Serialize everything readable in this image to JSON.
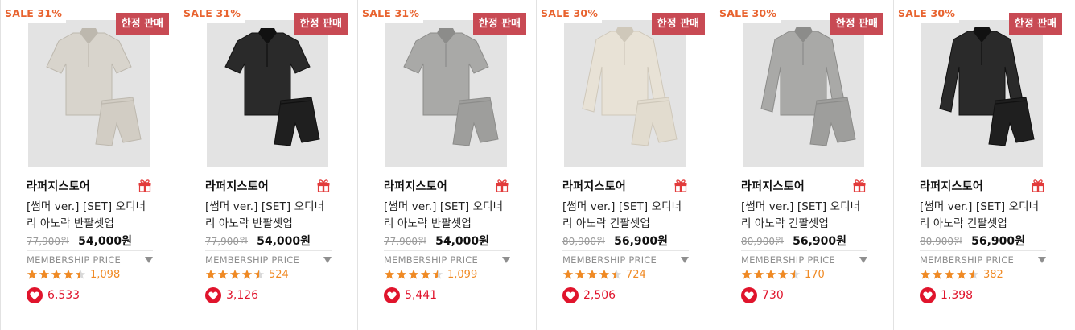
{
  "colors": {
    "sale_badge_text": "#e8632f",
    "limited_badge_bg": "#c84a54",
    "rating_star": "#f08a24",
    "like_heart": "#e0142c"
  },
  "membership_label": "MEMBERSHIP PRICE",
  "icons": {
    "gift": "gift-icon",
    "dropdown": "caret-down-icon",
    "rating": "star-icon",
    "like": "heart-icon"
  },
  "products": [
    {
      "sale": "SALE 31%",
      "limited": "한정 판매",
      "brand": "라퍼지스토어",
      "name": "[썸머 ver.] [SET] 오디너리 아노락 반팔셋업",
      "original_price": "77,900원",
      "price": "54,000원",
      "rating": 4.5,
      "reviews": "1,098",
      "likes": "6,533",
      "color": "light-beige",
      "sleeve": "short"
    },
    {
      "sale": "SALE 31%",
      "limited": "한정 판매",
      "brand": "라퍼지스토어",
      "name": "[썸머 ver.] [SET] 오디너리 아노락 반팔셋업",
      "original_price": "77,900원",
      "price": "54,000원",
      "rating": 4.5,
      "reviews": "524",
      "likes": "3,126",
      "color": "black",
      "sleeve": "short"
    },
    {
      "sale": "SALE 31%",
      "limited": "한정 판매",
      "brand": "라퍼지스토어",
      "name": "[썸머 ver.] [SET] 오디너리 아노락 반팔셋업",
      "original_price": "77,900원",
      "price": "54,000원",
      "rating": 4.5,
      "reviews": "1,099",
      "likes": "5,441",
      "color": "gray",
      "sleeve": "short"
    },
    {
      "sale": "SALE 30%",
      "limited": "한정 판매",
      "brand": "라퍼지스토어",
      "name": "[썸머 ver.] [SET] 오디너리 아노락 긴팔셋업",
      "original_price": "80,900원",
      "price": "56,900원",
      "rating": 4.5,
      "reviews": "724",
      "likes": "2,506",
      "color": "ivory",
      "sleeve": "long"
    },
    {
      "sale": "SALE 30%",
      "limited": "한정 판매",
      "brand": "라퍼지스토어",
      "name": "[썸머 ver.] [SET] 오디너리 아노락 긴팔셋업",
      "original_price": "80,900원",
      "price": "56,900원",
      "rating": 4.5,
      "reviews": "170",
      "likes": "730",
      "color": "gray",
      "sleeve": "long"
    },
    {
      "sale": "SALE 30%",
      "limited": "한정 판매",
      "brand": "라퍼지스토어",
      "name": "[썸머 ver.] [SET] 오디너리 아노락 긴팔셋업",
      "original_price": "80,900원",
      "price": "56,900원",
      "rating": 4.5,
      "reviews": "382",
      "likes": "1,398",
      "color": "black",
      "sleeve": "long"
    }
  ]
}
